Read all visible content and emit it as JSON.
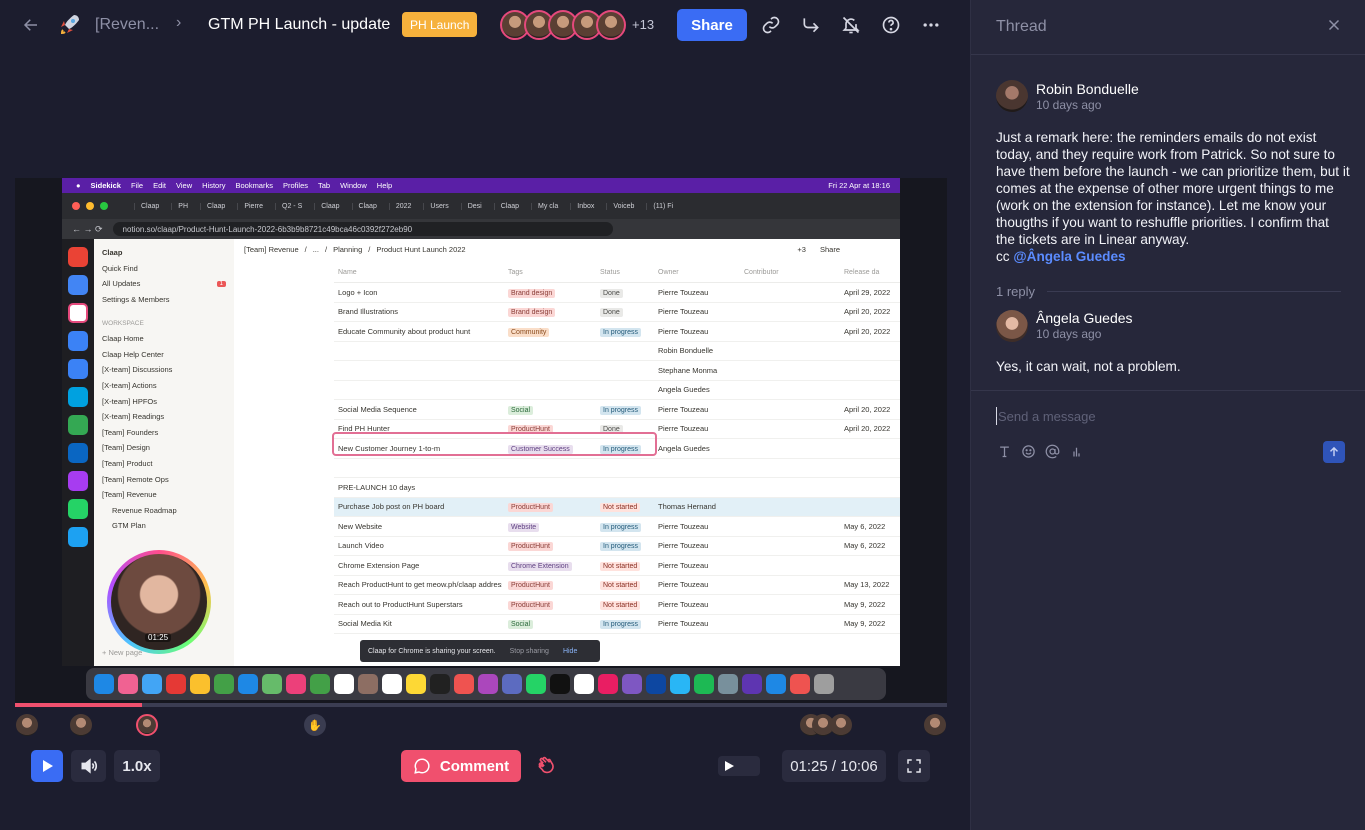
{
  "header": {
    "breadcrumb_parent": "[Reven...",
    "page_title": "GTM PH Launch - update",
    "tag": "PH Launch",
    "viewer_count": "+13",
    "share_label": "Share"
  },
  "video_content": {
    "menubar": {
      "items": [
        "Sidekick",
        "File",
        "Edit",
        "View",
        "History",
        "Bookmarks",
        "Profiles",
        "Tab",
        "Window",
        "Help"
      ],
      "clock": "Fri 22 Apr at 18:16"
    },
    "browser_tabs": [
      "Claap",
      "PH",
      "Claap",
      "Pierre",
      "Q2 - S",
      "Claap",
      "Claap",
      "2022",
      "Users",
      "Desi",
      "Claap",
      "My cla",
      "Inbox",
      "Voiceb",
      "(11) Fi"
    ],
    "url": "notion.so/claap/Product-Hunt-Launch-2022-6b3b9b8721c49bca46c0392f272eb90",
    "workspace_name": "Claap",
    "sidebar_top": [
      "Quick Find",
      "All Updates",
      "Settings & Members"
    ],
    "updates_badge": "1",
    "workspace_label": "WORKSPACE",
    "sidebar_items": [
      "Claap Home",
      "Claap Help Center",
      "[X-team] Discussions",
      "[X-team] Actions",
      "[X-team] HPFOs",
      "[X-team] Readings",
      "[Team] Founders",
      "[Team] Design",
      "[Team] Product",
      "[Team] Remote Ops",
      "[Team] Revenue",
      "Revenue Roadmap",
      "GTM Plan"
    ],
    "new_page": "New page",
    "notion_breadcrumb": [
      "[Team] Revenue",
      "...",
      "Planning",
      "Product Hunt Launch 2022"
    ],
    "notion_viewers": "+3",
    "notion_share": "Share",
    "columns": [
      "Name",
      "Tags",
      "Status",
      "Owner",
      "Contributor",
      "Release da"
    ],
    "rows": [
      {
        "name": "Logo + Icon",
        "tag": "Brand design",
        "tag_class": "p-brand",
        "status": "Done",
        "status_class": "p-done",
        "owner": "Pierre Touzeau",
        "date": "April 29, 2022"
      },
      {
        "name": "Brand Illustrations",
        "tag": "Brand design",
        "tag_class": "p-brand",
        "status": "Done",
        "status_class": "p-done",
        "owner": "Pierre Touzeau",
        "date": "April 20, 2022"
      },
      {
        "name": "Educate Community about product hunt",
        "tag": "Community",
        "tag_class": "p-comm",
        "status": "In progress",
        "status_class": "p-prog",
        "owner": "Pierre Touzeau",
        "date": "April 20, 2022"
      },
      {
        "name": "",
        "tag": "",
        "tag_class": "",
        "status": "",
        "status_class": "",
        "owner": "Robin Bonduelle",
        "date": ""
      },
      {
        "name": "",
        "tag": "",
        "tag_class": "",
        "status": "",
        "status_class": "",
        "owner": "Stephane Monma",
        "date": ""
      },
      {
        "name": "",
        "tag": "",
        "tag_class": "",
        "status": "",
        "status_class": "",
        "owner": "Angela Guedes",
        "date": ""
      },
      {
        "name": "Social Media Sequence",
        "tag": "Social",
        "tag_class": "p-social",
        "status": "In progress",
        "status_class": "p-prog",
        "owner": "Pierre Touzeau",
        "date": "April 20, 2022"
      },
      {
        "name": "Find PH Hunter",
        "tag": "ProductHunt",
        "tag_class": "p-ph",
        "status": "Done",
        "status_class": "p-done",
        "owner": "Pierre Touzeau",
        "date": "April 20, 2022"
      },
      {
        "name": "New Customer Journey 1-to-m",
        "tag": "Customer Success",
        "tag_class": "p-cs",
        "status": "In progress",
        "status_class": "p-prog",
        "owner": "Angela Guedes",
        "date": ""
      },
      {
        "name": "",
        "tag": "",
        "tag_class": "",
        "status": "",
        "status_class": "",
        "owner": "",
        "date": ""
      },
      {
        "name": "PRE-LAUNCH 10 days",
        "tag": "",
        "tag_class": "",
        "status": "",
        "status_class": "",
        "owner": "",
        "date": ""
      },
      {
        "name": "Purchase Job post on PH board",
        "tag": "ProductHunt",
        "tag_class": "p-ph",
        "status": "Not started",
        "status_class": "p-ns",
        "owner": "Thomas Hernand",
        "date": ""
      },
      {
        "name": "New Website",
        "tag": "Website",
        "tag_class": "p-web",
        "status": "In progress",
        "status_class": "p-prog",
        "owner": "Pierre Touzeau",
        "date": "May 6, 2022"
      },
      {
        "name": "Launch Video",
        "tag": "ProductHunt",
        "tag_class": "p-ph",
        "status": "In progress",
        "status_class": "p-prog",
        "owner": "Pierre Touzeau",
        "date": "May 6, 2022"
      },
      {
        "name": "Chrome Extension Page",
        "tag": "Chrome Extension",
        "tag_class": "p-cs",
        "status": "Not started",
        "status_class": "p-ns",
        "owner": "Pierre Touzeau",
        "date": ""
      },
      {
        "name": "Reach ProductHunt to get meow.ph/claap address",
        "tag": "ProductHunt",
        "tag_class": "p-ph",
        "status": "Not started",
        "status_class": "p-ns",
        "owner": "Pierre Touzeau",
        "date": "May 13, 2022"
      },
      {
        "name": "Reach out to ProductHunt Superstars",
        "tag": "ProductHunt",
        "tag_class": "p-ph",
        "status": "Not started",
        "status_class": "p-ns",
        "owner": "Pierre Touzeau",
        "date": "May 9, 2022"
      },
      {
        "name": "Social Media Kit",
        "tag": "Social",
        "tag_class": "p-social",
        "status": "In progress",
        "status_class": "p-prog",
        "owner": "Pierre Touzeau",
        "date": "May 9, 2022"
      }
    ],
    "camera_time": "01:25",
    "share_toast": {
      "text": "Claap for Chrome is sharing your screen.",
      "stop": "Stop sharing",
      "hide": "Hide"
    }
  },
  "player": {
    "progress": 0.136,
    "speed_label": "1.0x",
    "comment_label": "Comment",
    "time_display": "01:25 / 10:06"
  },
  "thread": {
    "title": "Thread",
    "messages": [
      {
        "author": "Robin Bonduelle",
        "time": "10 days ago",
        "body": "Just a remark here: the reminders emails do not exist today, and they require work from Patrick. So not sure to have them before the launch - we can prioritize them, but it comes at the expense of other more urgent things to me (work on the extension for instance). Let me know your thougths if you want to reshuffle priorities. I confirm that the tickets are in Linear anyway.",
        "cc_prefix": "cc ",
        "mention": "@Ângela Guedes"
      },
      {
        "author": "Ângela Guedes",
        "time": "10 days ago",
        "body": "Yes, it can wait, not a problem."
      }
    ],
    "reply_count": "1 reply",
    "composer_placeholder": "Send a message"
  },
  "colors": {
    "accent_blue": "#3a6cf4",
    "accent_pink": "#f0506e",
    "tag_orange": "#f6b13c",
    "bg_main": "#1c1d2e",
    "bg_thread": "#26273a"
  }
}
